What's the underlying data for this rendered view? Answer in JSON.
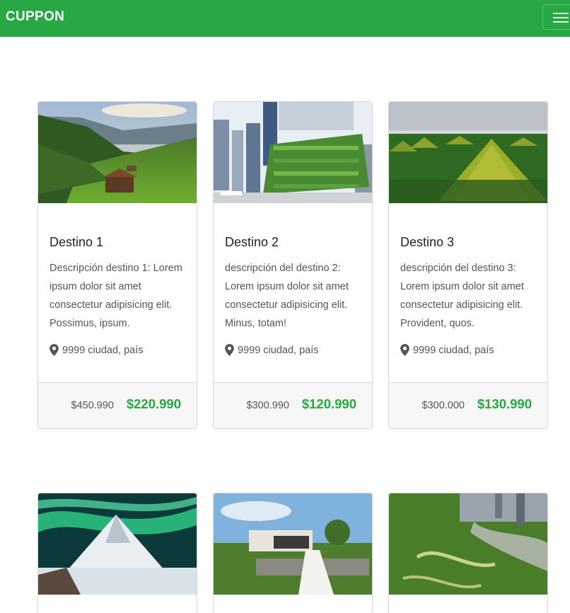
{
  "navbar": {
    "brand": "CUPPON",
    "menu_icon": "hamburger-menu-icon",
    "color": "#28a745"
  },
  "cards": [
    {
      "title": "Destino 1",
      "description": "Descripción destino 1: Lorem ipsum dolor sit amet consectetur adipisicing elit. Possimus, ipsum.",
      "location": "9999 ciudad, país",
      "old_price": "$450.990",
      "new_price": "$220.990",
      "image": "alpine-valley-photo"
    },
    {
      "title": "Destino 2",
      "description": "descripción del destino 2: Lorem ipsum dolor sit amet consectetur adipisicing elit. Minus, totam!",
      "location": "9999 ciudad, país",
      "old_price": "$300.990",
      "new_price": "$120.990",
      "image": "green-skyscraper-photo"
    },
    {
      "title": "Destino 3",
      "description": "descripción del destino 3: Lorem ipsum dolor sit amet consectetur adipisicing elit. Provident, quos.",
      "location": "9999 ciudad, país",
      "old_price": "$300.000",
      "new_price": "$130.990",
      "image": "chocolate-hills-photo"
    }
  ],
  "cards_row2": [
    {
      "image": "aurora-mountain-photo"
    },
    {
      "image": "green-roof-building-photo"
    },
    {
      "image": "aerial-river-city-photo"
    }
  ],
  "icons": {
    "location": "map-pin-icon"
  }
}
